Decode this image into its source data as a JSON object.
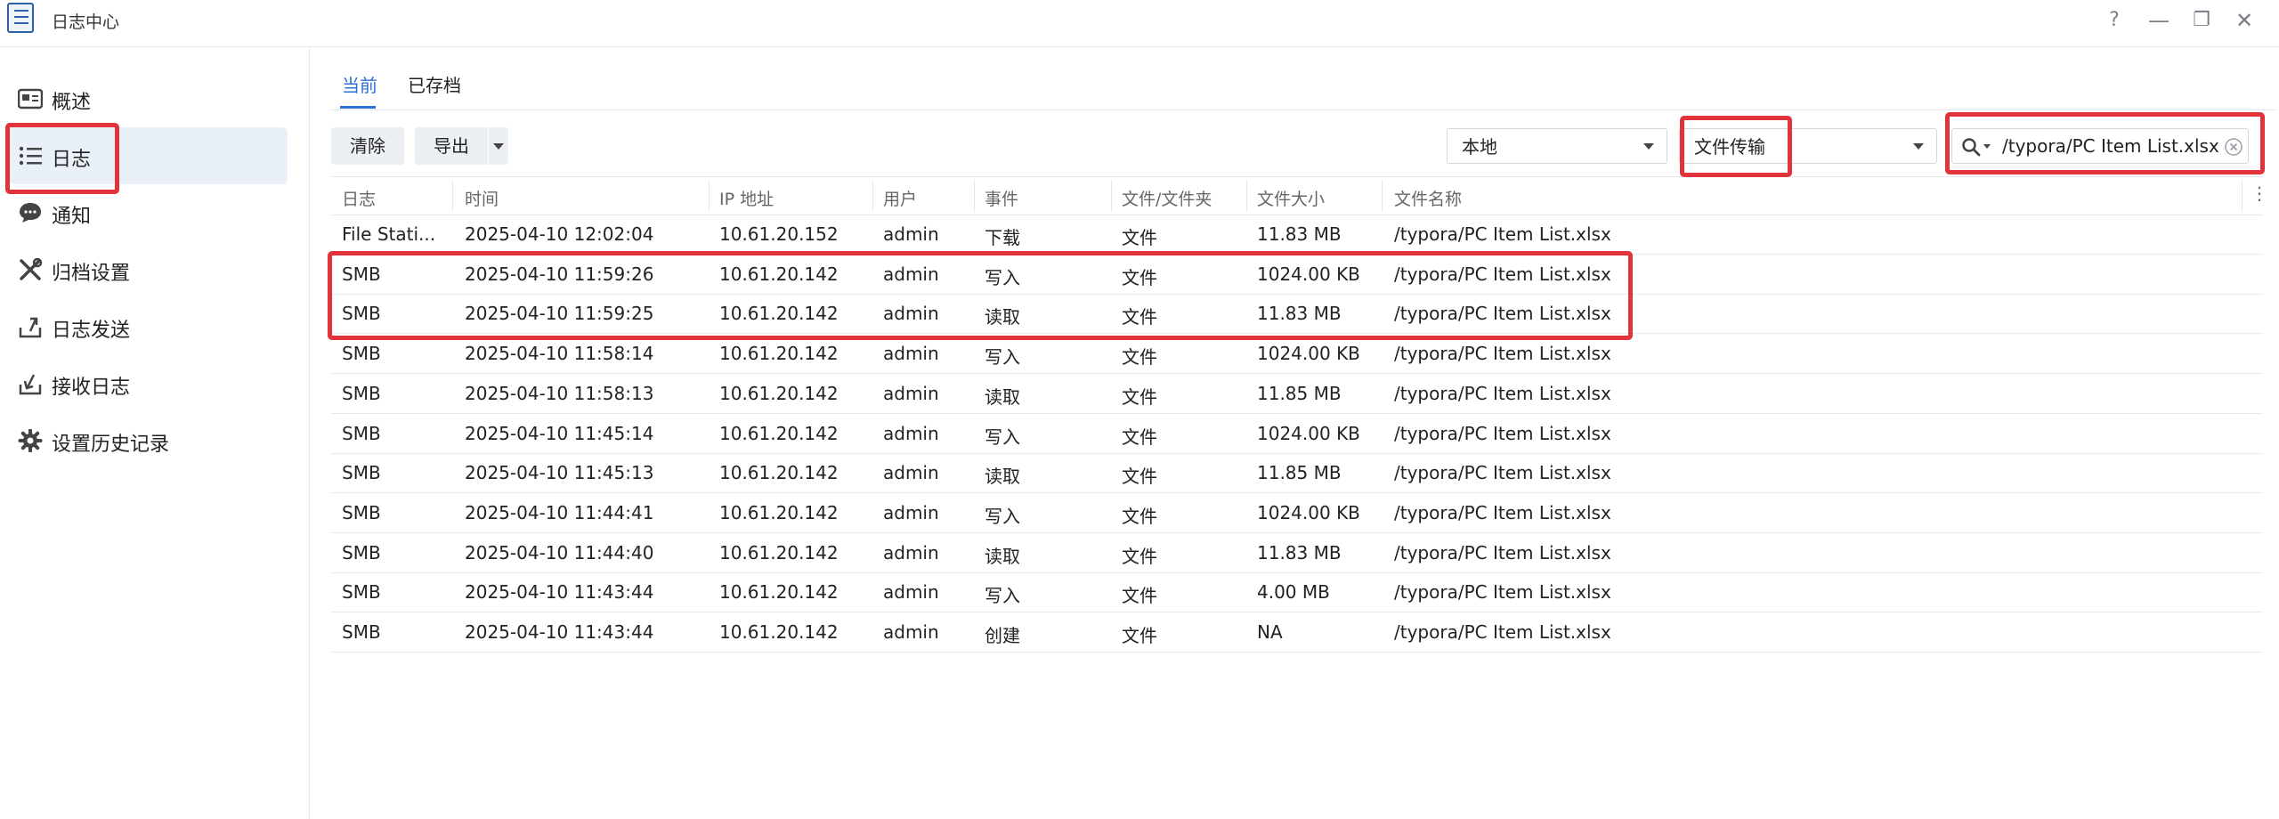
{
  "window": {
    "title": "日志中心",
    "help": "?",
    "minimize": "—",
    "restore": "❐",
    "close": "✕"
  },
  "sidebar": {
    "items": [
      {
        "label": "概述",
        "icon": "overview-icon"
      },
      {
        "label": "日志",
        "icon": "list-icon"
      },
      {
        "label": "通知",
        "icon": "chat-bubble-icon"
      },
      {
        "label": "归档设置",
        "icon": "tools-icon"
      },
      {
        "label": "日志发送",
        "icon": "upload-icon"
      },
      {
        "label": "接收日志",
        "icon": "download-icon"
      },
      {
        "label": "设置历史记录",
        "icon": "gear-icon"
      }
    ]
  },
  "tabs": [
    {
      "label": "当前"
    },
    {
      "label": "已存档"
    }
  ],
  "toolbar": {
    "clear_label": "清除",
    "export_label": "导出",
    "source_value": "本地",
    "type_value": "文件传输",
    "search_value": "/typora/PC Item List.xlsx"
  },
  "table": {
    "columns": [
      "日志",
      "时间",
      "IP 地址",
      "用户",
      "事件",
      "文件/文件夹",
      "文件大小",
      "文件名称"
    ],
    "rows": [
      [
        "File Stati...",
        "2025-04-10 12:02:04",
        "10.61.20.152",
        "admin",
        "下载",
        "文件",
        "11.83 MB",
        "/typora/PC Item List.xlsx"
      ],
      [
        "SMB",
        "2025-04-10 11:59:26",
        "10.61.20.142",
        "admin",
        "写入",
        "文件",
        "1024.00 KB",
        "/typora/PC Item List.xlsx"
      ],
      [
        "SMB",
        "2025-04-10 11:59:25",
        "10.61.20.142",
        "admin",
        "读取",
        "文件",
        "11.83 MB",
        "/typora/PC Item List.xlsx"
      ],
      [
        "SMB",
        "2025-04-10 11:58:14",
        "10.61.20.142",
        "admin",
        "写入",
        "文件",
        "1024.00 KB",
        "/typora/PC Item List.xlsx"
      ],
      [
        "SMB",
        "2025-04-10 11:58:13",
        "10.61.20.142",
        "admin",
        "读取",
        "文件",
        "11.85 MB",
        "/typora/PC Item List.xlsx"
      ],
      [
        "SMB",
        "2025-04-10 11:45:14",
        "10.61.20.142",
        "admin",
        "写入",
        "文件",
        "1024.00 KB",
        "/typora/PC Item List.xlsx"
      ],
      [
        "SMB",
        "2025-04-10 11:45:13",
        "10.61.20.142",
        "admin",
        "读取",
        "文件",
        "11.85 MB",
        "/typora/PC Item List.xlsx"
      ],
      [
        "SMB",
        "2025-04-10 11:44:41",
        "10.61.20.142",
        "admin",
        "写入",
        "文件",
        "1024.00 KB",
        "/typora/PC Item List.xlsx"
      ],
      [
        "SMB",
        "2025-04-10 11:44:40",
        "10.61.20.142",
        "admin",
        "读取",
        "文件",
        "11.83 MB",
        "/typora/PC Item List.xlsx"
      ],
      [
        "SMB",
        "2025-04-10 11:43:44",
        "10.61.20.142",
        "admin",
        "写入",
        "文件",
        "4.00 MB",
        "/typora/PC Item List.xlsx"
      ],
      [
        "SMB",
        "2025-04-10 11:43:44",
        "10.61.20.142",
        "admin",
        "创建",
        "文件",
        "NA",
        "/typora/PC Item List.xlsx"
      ]
    ]
  },
  "colors": {
    "accent": "#2c6fd6",
    "highlight": "#e2323a",
    "active_bg": "#eaf0f8"
  }
}
